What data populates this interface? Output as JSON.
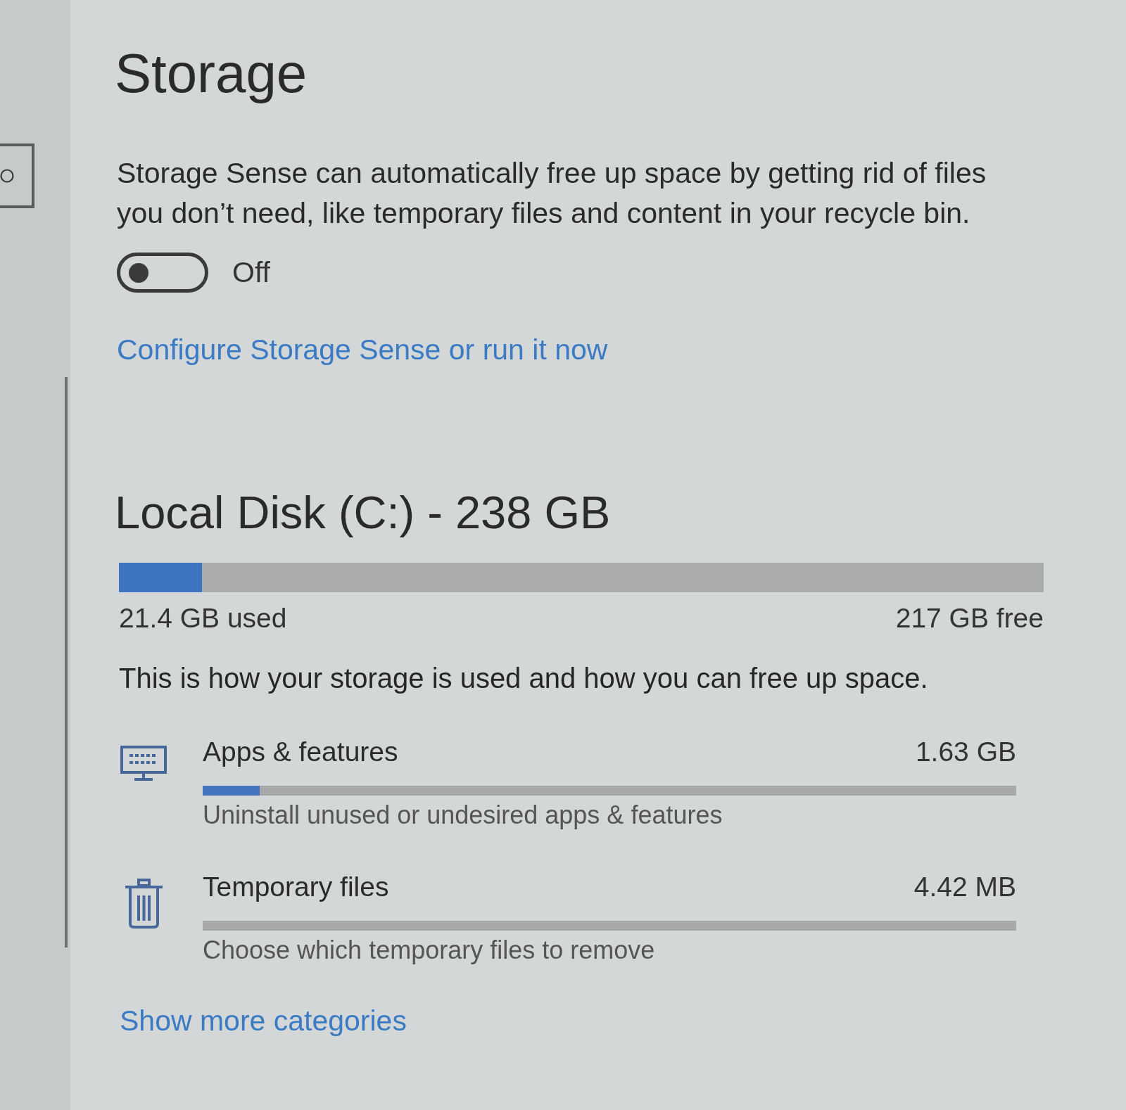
{
  "page": {
    "title": "Storage"
  },
  "storage_sense": {
    "description": "Storage Sense can automatically free up space by getting rid of files you don’t need, like temporary files and content in your recycle bin.",
    "toggle": {
      "on": false,
      "label": "Off"
    },
    "link": "Configure Storage Sense or run it now"
  },
  "disk": {
    "title": "Local Disk (C:) - 238 GB",
    "level": 0.09,
    "used": "21.4 GB used",
    "free": "217 GB free",
    "description": "This is how your storage is used and how you can free up space.",
    "categories": [
      {
        "kind": "apps",
        "name": "Apps & features",
        "size": "1.63 GB",
        "level": 0.07,
        "hint": "Uninstall unused or undesired apps & features"
      },
      {
        "kind": "temp",
        "name": "Temporary files",
        "size": "4.42 MB",
        "hint": "Choose which temporary files to remove"
      }
    ],
    "more_link": "Show more categories"
  }
}
